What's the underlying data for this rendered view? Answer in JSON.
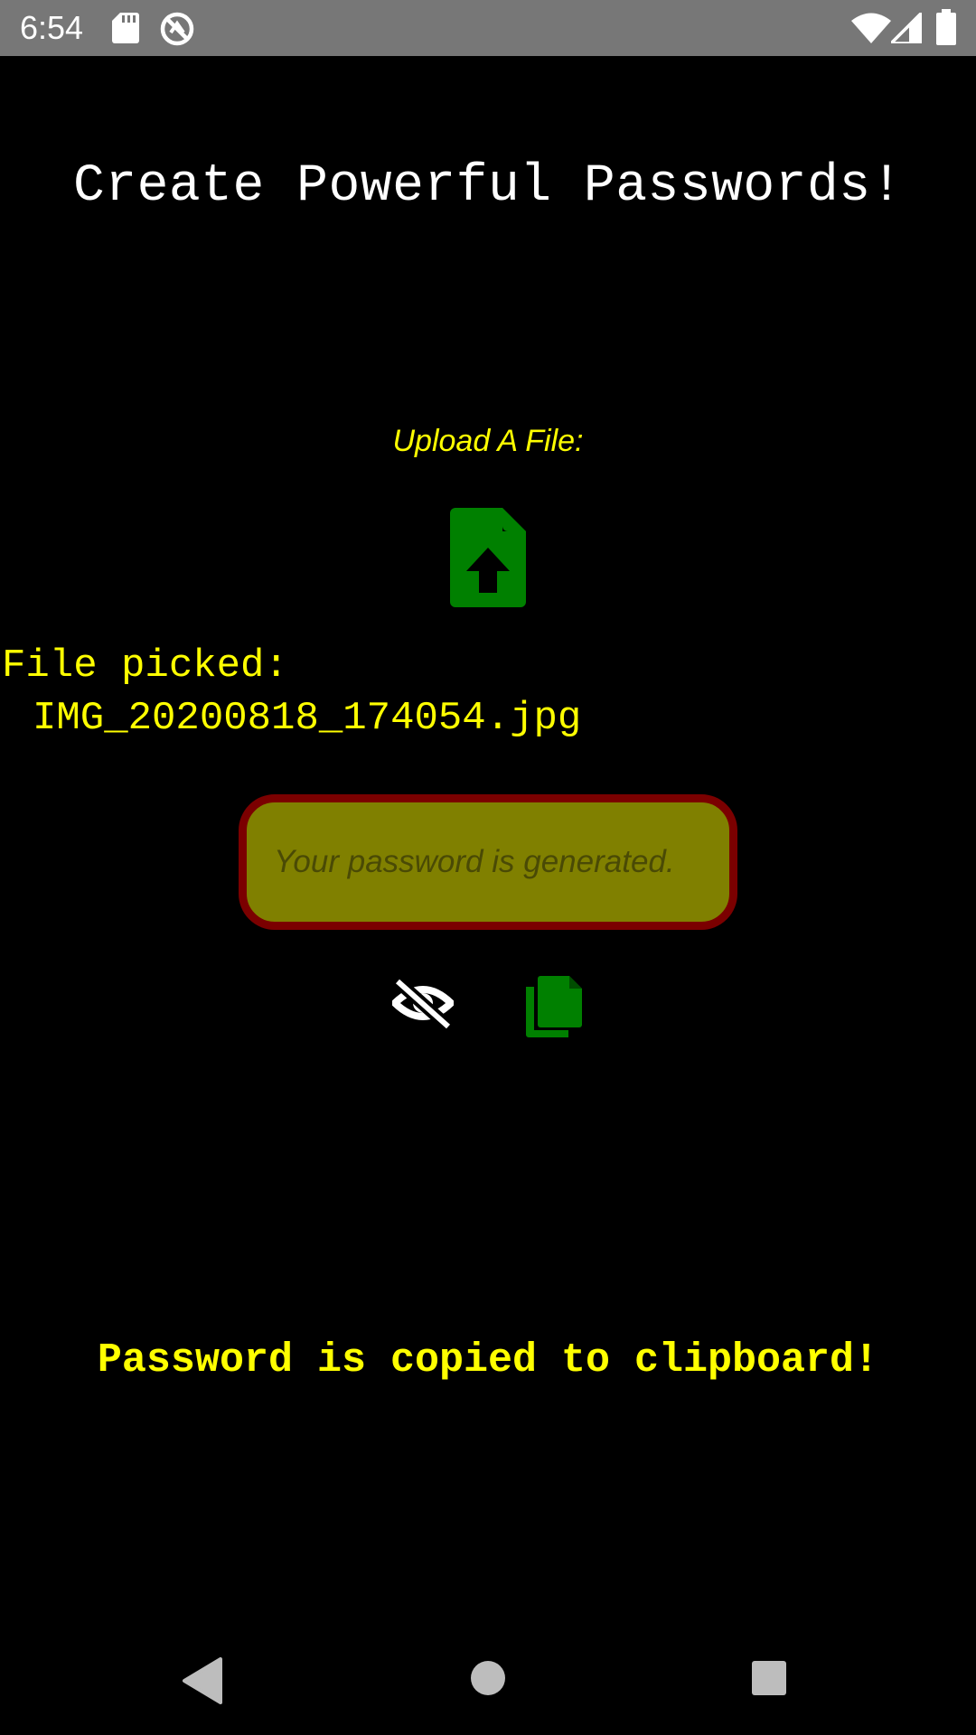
{
  "status_bar": {
    "time": "6:54",
    "icons": [
      "sd-card-icon",
      "sync-icon",
      "wifi-icon",
      "cell-signal-icon",
      "battery-icon"
    ]
  },
  "app": {
    "title": "Create Powerful Passwords!",
    "upload_label": "Upload A File:",
    "upload_icon": "file-upload-icon",
    "file_picked_label": "File picked:",
    "file_name": "IMG_20200818_174054.jpg",
    "password_field": {
      "value": "",
      "placeholder": "Your password is generated."
    },
    "visibility_icon": "eye-slash-icon",
    "copy_icon": "copy-icon",
    "copied_message": "Password is copied to clipboard!"
  },
  "nav_bar": {
    "icons": [
      "back-icon",
      "home-icon",
      "recents-icon"
    ]
  },
  "colors": {
    "background": "#000000",
    "status_bar": "#777777",
    "title": "#ffffff",
    "accent_text": "#ffff00",
    "icon_green": "#008000",
    "field_fill": "#808000",
    "field_border": "#7b0000"
  }
}
